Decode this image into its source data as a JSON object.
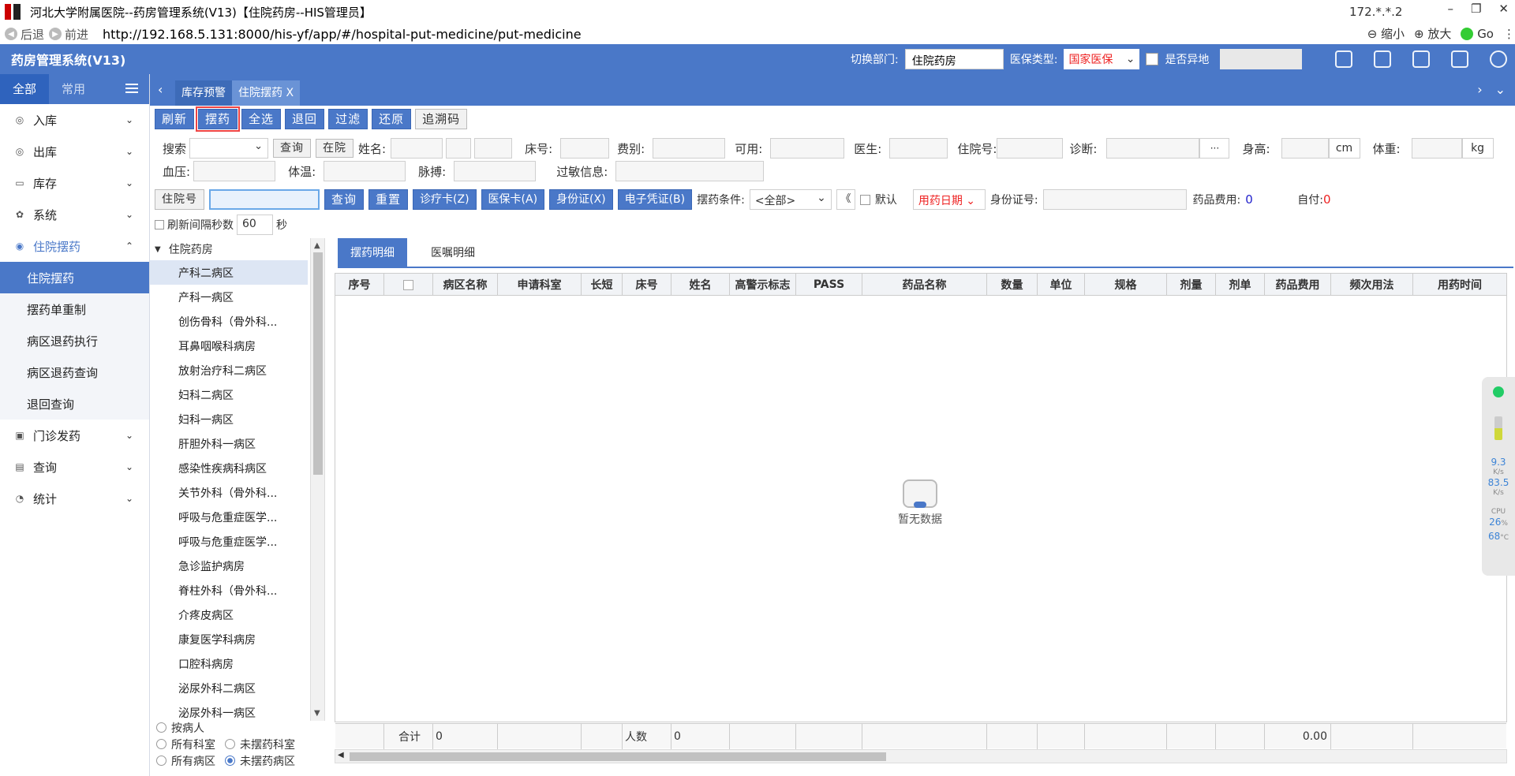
{
  "window": {
    "title": "河北大学附属医院--药房管理系统(V13)【住院药房--HIS管理员】",
    "ip": "172.*.*.2"
  },
  "browser": {
    "back": "后退",
    "forward": "前进",
    "url": "http://192.168.5.131:8000/his-yf/app/#/hospital-put-medicine/put-medicine",
    "zoom_out": "缩小",
    "zoom_in": "放大",
    "go": "Go"
  },
  "header": {
    "app_title": "药房管理系统(V13)",
    "dept_label": "切换部门:",
    "dept_value": "住院药房",
    "insurance_label": "医保类型:",
    "insurance_value": "国家医保",
    "remote_label": "是否异地"
  },
  "sidebar": {
    "tabs": [
      "全部",
      "常用"
    ],
    "items": [
      {
        "label": "入库",
        "icon": "warehouse-in-icon"
      },
      {
        "label": "出库",
        "icon": "warehouse-out-icon"
      },
      {
        "label": "库存",
        "icon": "stock-icon"
      },
      {
        "label": "系统",
        "icon": "gear-icon"
      },
      {
        "label": "住院摆药",
        "icon": "ward-icon"
      }
    ],
    "sub_items": [
      "住院摆药",
      "摆药单重制",
      "病区退药执行",
      "病区退药查询",
      "退回查询"
    ],
    "items_after": [
      {
        "label": "门诊发药",
        "icon": "outpatient-icon"
      },
      {
        "label": "查询",
        "icon": "query-icon"
      },
      {
        "label": "统计",
        "icon": "stats-icon"
      }
    ]
  },
  "tabs": {
    "tab1": "库存预警",
    "tab2": "住院摆药",
    "close": "X"
  },
  "toolbar": {
    "refresh": "刷新",
    "dispense": "摆药",
    "select_all": "全选",
    "return": "退回",
    "filter": "过滤",
    "restore": "还原",
    "trace": "追溯码"
  },
  "patient_form": {
    "search": "搜索",
    "query": "查询",
    "in_hospital": "在院",
    "name": "姓名:",
    "bed": "床号:",
    "fee_type": "费别:",
    "available": "可用:",
    "doctor": "医生:",
    "inpatient_no": "住院号:",
    "diagnosis": "诊断:",
    "diagnosis_btn": "···",
    "height": "身高:",
    "height_unit": "cm",
    "weight": "体重:",
    "weight_unit": "kg",
    "bp": "血压:",
    "temp": "体温:",
    "pulse": "脉搏:",
    "allergy": "过敏信息:"
  },
  "search_row": {
    "inpatient_no_label": "住院号",
    "query": "查询",
    "reset": "重置",
    "clinic_card": "诊疗卡(Z)",
    "insurance_card": "医保卡(A)",
    "id_card": "身份证(X)",
    "e_voucher": "电子凭证(B)",
    "cond_label": "摆药条件:",
    "cond_value": "<全部>",
    "collapse": "《",
    "default": "默认",
    "date_type": "用药日期",
    "id_no_label": "身份证号:",
    "drug_fee_label": "药品费用:",
    "drug_fee_value": "0",
    "self_pay_label": "自付:",
    "self_pay_value": "0"
  },
  "refresh_row": {
    "label": "刷新间隔秒数",
    "value": "60",
    "unit": "秒"
  },
  "tree": {
    "root": "住院药房",
    "nodes": [
      "产科二病区",
      "产科一病区",
      "创伤骨科（骨外科...",
      "耳鼻咽喉科病房",
      "放射治疗科二病区",
      "妇科二病区",
      "妇科一病区",
      "肝胆外科一病区",
      "感染性疾病科病区",
      "关节外科（骨外科...",
      "呼吸与危重症医学...",
      "呼吸与危重症医学...",
      "急诊监护病房",
      "脊柱外科（骨外科...",
      "介疼皮病区",
      "康复医学科病房",
      "口腔科病房",
      "泌尿外科二病区",
      "泌尿外科一病区"
    ]
  },
  "radios": {
    "by_patient": "按病人",
    "all_depts": "所有科室",
    "undispensed_depts": "未摆药科室",
    "all_wards": "所有病区",
    "undispensed_wards": "未摆药病区"
  },
  "detail_tabs": [
    "摆药明细",
    "医嘱明细"
  ],
  "grid": {
    "columns": [
      "序号",
      "",
      "病区名称",
      "申请科室",
      "长短",
      "床号",
      "姓名",
      "高警示标志",
      "PASS",
      "药品名称",
      "数量",
      "单位",
      "规格",
      "剂量",
      "剂单",
      "药品费用",
      "频次用法",
      "用药时间"
    ],
    "empty_text": "暂无数据",
    "footer": {
      "total_label": "合计",
      "total_value": "0",
      "count_label": "人数",
      "count_value": "0",
      "fee_total": "0.00"
    }
  },
  "widget": {
    "v1": "9.3",
    "u1": "K/s",
    "v2": "83.5",
    "u2": "K/s",
    "cpu": "CPU",
    "cpu_v": "26",
    "cpu_u": "%",
    "temp_v": "68",
    "temp_u": "°C"
  }
}
